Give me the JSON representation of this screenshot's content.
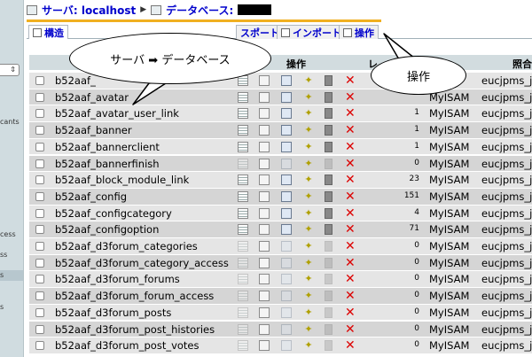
{
  "breadcrumb": {
    "server_label": "サーバ: localhost",
    "arrow": "▶",
    "db_label": "データベース:"
  },
  "tabs": [
    {
      "label": "構造"
    },
    {
      "label": "スポート"
    },
    {
      "label": "インポート"
    },
    {
      "label": "操作"
    }
  ],
  "header": {
    "ops": "操作",
    "records": "レ",
    "collation": "照合"
  },
  "sidebar": {
    "frags": [
      "cants",
      "cess",
      "ss",
      "s",
      "s"
    ]
  },
  "rows": [
    {
      "name": "b52aaf_",
      "records": "",
      "engine": "",
      "collation": "eucjpms_jap",
      "dim": false
    },
    {
      "name": "b52aaf_avatar",
      "records": "",
      "engine": "MyISAM",
      "collation": "eucjpms_jap",
      "dim": false
    },
    {
      "name": "b52aaf_avatar_user_link",
      "records": "1",
      "engine": "MyISAM",
      "collation": "eucjpms_jap",
      "dim": false
    },
    {
      "name": "b52aaf_banner",
      "records": "1",
      "engine": "MyISAM",
      "collation": "eucjpms_jap",
      "dim": false
    },
    {
      "name": "b52aaf_bannerclient",
      "records": "1",
      "engine": "MyISAM",
      "collation": "eucjpms_jap",
      "dim": false
    },
    {
      "name": "b52aaf_bannerfinish",
      "records": "0",
      "engine": "MyISAM",
      "collation": "eucjpms_jap",
      "dim": true
    },
    {
      "name": "b52aaf_block_module_link",
      "records": "23",
      "engine": "MyISAM",
      "collation": "eucjpms_jap",
      "dim": false
    },
    {
      "name": "b52aaf_config",
      "records": "151",
      "engine": "MyISAM",
      "collation": "eucjpms_jap",
      "dim": false
    },
    {
      "name": "b52aaf_configcategory",
      "records": "4",
      "engine": "MyISAM",
      "collation": "eucjpms_jap",
      "dim": false
    },
    {
      "name": "b52aaf_configoption",
      "records": "71",
      "engine": "MyISAM",
      "collation": "eucjpms_jap",
      "dim": false
    },
    {
      "name": "b52aaf_d3forum_categories",
      "records": "0",
      "engine": "MyISAM",
      "collation": "eucjpms_jap",
      "dim": true
    },
    {
      "name": "b52aaf_d3forum_category_access",
      "records": "0",
      "engine": "MyISAM",
      "collation": "eucjpms_jap",
      "dim": true
    },
    {
      "name": "b52aaf_d3forum_forums",
      "records": "0",
      "engine": "MyISAM",
      "collation": "eucjpms_jap",
      "dim": true
    },
    {
      "name": "b52aaf_d3forum_forum_access",
      "records": "0",
      "engine": "MyISAM",
      "collation": "eucjpms_jap",
      "dim": true
    },
    {
      "name": "b52aaf_d3forum_posts",
      "records": "0",
      "engine": "MyISAM",
      "collation": "eucjpms_jap",
      "dim": true
    },
    {
      "name": "b52aaf_d3forum_post_histories",
      "records": "0",
      "engine": "MyISAM",
      "collation": "eucjpms_jap",
      "dim": true
    },
    {
      "name": "b52aaf_d3forum_post_votes",
      "records": "0",
      "engine": "MyISAM",
      "collation": "eucjpms_jap",
      "dim": true
    }
  ],
  "callouts": {
    "left": "サーバ ➡ データベース",
    "right": "操作"
  }
}
